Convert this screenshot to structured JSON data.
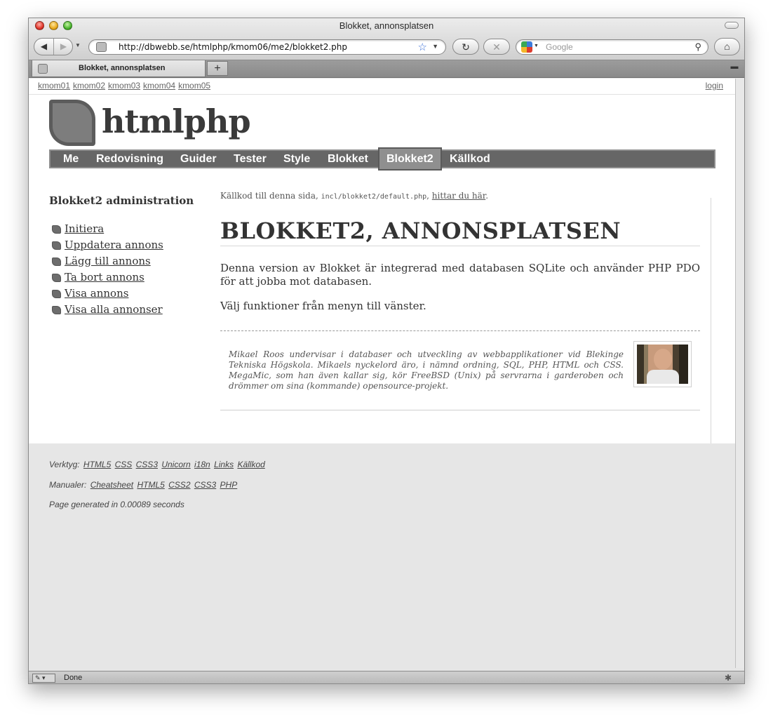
{
  "browser": {
    "window_title": "Blokket, annonsplatsen",
    "url": "http://dbwebb.se/htmlphp/kmom06/me2/blokket2.php",
    "search_placeholder": "Google",
    "tab_title": "Blokket, annonsplatsen",
    "new_tab": "+",
    "status": "Done"
  },
  "page": {
    "top_links": [
      "kmom01",
      "kmom02",
      "kmom03",
      "kmom04",
      "kmom05"
    ],
    "login": "login",
    "logo": "htmlphp",
    "nav": [
      "Me",
      "Redovisning",
      "Guider",
      "Tester",
      "Style",
      "Blokket",
      "Blokket2",
      "Källkod"
    ],
    "nav_active": "Blokket2",
    "sidebar": {
      "title": "Blokket2 administration",
      "items": [
        "Initiera",
        "Uppdatera annons",
        "Lägg till annons",
        "Ta bort annons",
        "Visa annons",
        "Visa alla annonser"
      ]
    },
    "source_note": {
      "prefix": "Källkod till denna sida,",
      "file": "incl/blokket2/default.php",
      "link": "hittar du här"
    },
    "heading": "BLOKKET2, ANNONSPLATSEN",
    "paragraph1": "Denna version av Blokket är integrerad med databasen SQLite och använder PHP PDO för att jobba mot databasen.",
    "paragraph2": "Välj funktioner från menyn till vänster.",
    "byline": "Mikael Roos undervisar i databaser och utveckling av webbapplikationer vid Blekinge Tekniska Högskola. Mikaels nyckelord äro, i nämnd ordning, SQL, PHP, HTML och CSS. MegaMic, som han även kallar sig, kör FreeBSD (Unix) på servrarna i garderoben och drömmer om sina (kommande) opensource-projekt.",
    "footer": {
      "tools_label": "Verktyg:",
      "tools": [
        "HTML5",
        "CSS",
        "CSS3",
        "Unicorn",
        "i18n",
        "Links",
        "Källkod"
      ],
      "manuals_label": "Manualer:",
      "manuals": [
        "Cheatsheet",
        "HTML5",
        "CSS2",
        "CSS3",
        "PHP"
      ],
      "generated": "Page generated in 0.00089 seconds"
    }
  }
}
